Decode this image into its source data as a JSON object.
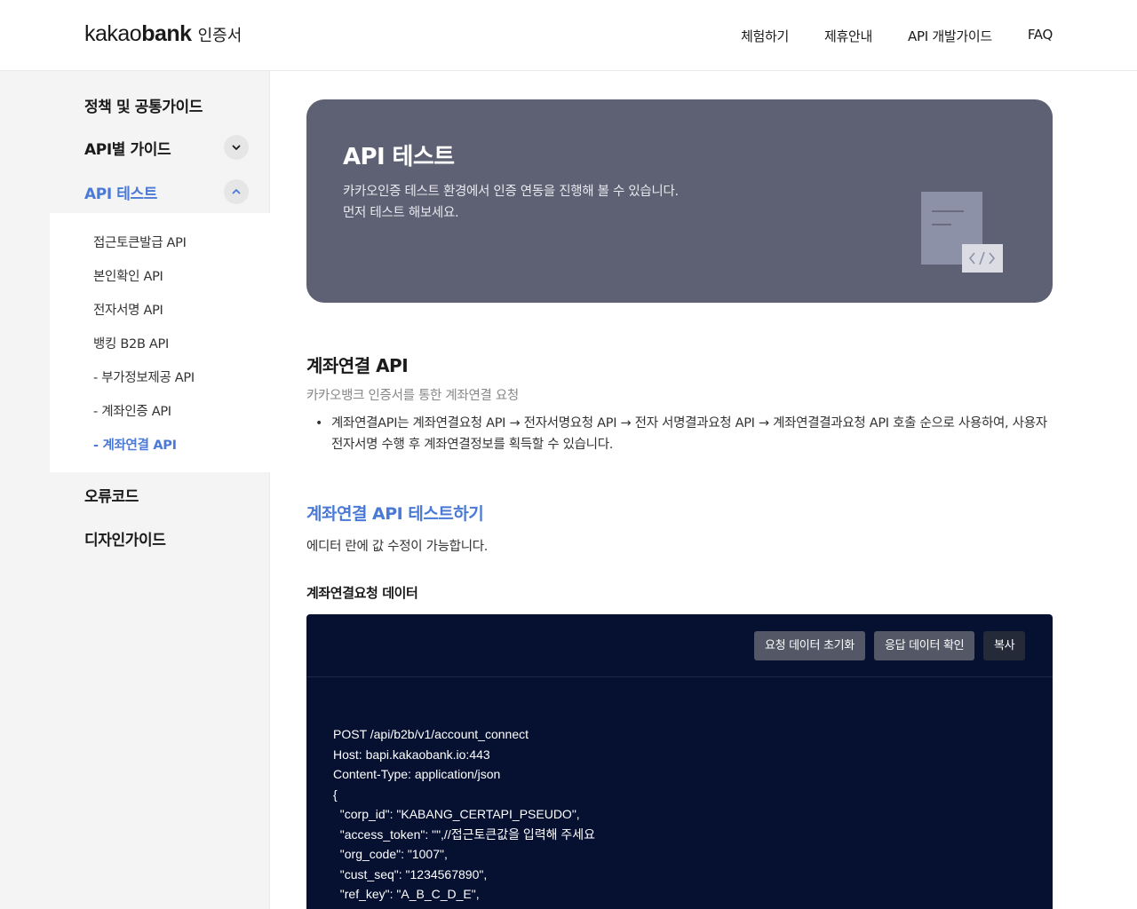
{
  "header": {
    "logo_light": "kakao",
    "logo_bold": "bank",
    "logo_sub": "인증서",
    "nav": [
      "체험하기",
      "제휴안내",
      "API 개발가이드",
      "FAQ"
    ]
  },
  "sidebar": {
    "policy": "정책 및 공통가이드",
    "api_guide": "API별 가이드",
    "api_test": "API 테스트",
    "sub_items": [
      "접근토큰발급 API",
      "본인확인 API",
      "전자서명 API",
      "뱅킹 B2B API",
      "- 부가정보제공 API",
      "- 계좌인증 API",
      "- 계좌연결 API"
    ],
    "error_code": "오류코드",
    "design_guide": "디자인가이드"
  },
  "hero": {
    "title": "API 테스트",
    "desc_line1": "카카오인증 테스트 환경에서 인증 연동을 진행해 볼 수 있습니다.",
    "desc_line2": "먼저 테스트 해보세요."
  },
  "section": {
    "title": "계좌연결 API",
    "subtitle": "카카오뱅크 인증서를 통한 계좌연결 요청",
    "bullet": "계좌연결API는 계좌연결요청 API → 전자서명요청 API → 전자 서명결과요청 API → 계좌연결결과요청 API 호출 순으로 사용하여, 사용자 전자서명 수행 후 계좌연결정보를 획득할 수 있습니다."
  },
  "test": {
    "title": "계좌연결 API 테스트하기",
    "desc": "에디터 란에 값 수정이 가능합니다.",
    "data_label": "계좌연결요청 데이터"
  },
  "editor": {
    "btn_reset": "요청 데이터 초기화",
    "btn_response": "응답 데이터 확인",
    "btn_copy": "복사",
    "code_lines": [
      "POST /api/b2b/v1/account_connect",
      "Host: bapi.kakaobank.io:443",
      "Content-Type: application/json",
      "{",
      "  \"corp_id\": \"KABANG_CERTAPI_PSEUDO\",",
      "  \"access_token\": \"\",//접근토큰값을 입력해 주세요",
      "  \"org_code\": \"1007\",",
      "  \"cust_seq\": \"1234567890\",",
      "  \"ref_key\": \"A_B_C_D_E\","
    ]
  },
  "colors": {
    "accent": "#4a79d6",
    "hero_bg": "#5e6073",
    "editor_bg": "#061131",
    "sidebar_bg": "#f4f4f4"
  }
}
